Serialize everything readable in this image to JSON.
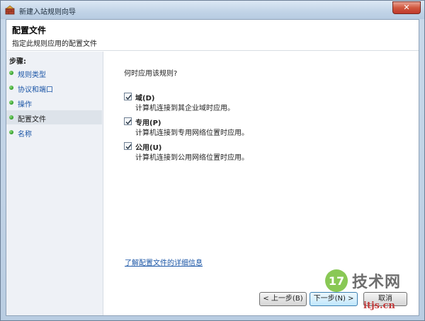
{
  "window": {
    "title": "新建入站规则向导",
    "close_glyph": "✕"
  },
  "header": {
    "title": "配置文件",
    "subtitle": "指定此规则应用的配置文件"
  },
  "sidebar": {
    "label": "步骤:",
    "items": [
      {
        "label": "规则类型",
        "current": false
      },
      {
        "label": "协议和端口",
        "current": false
      },
      {
        "label": "操作",
        "current": false
      },
      {
        "label": "配置文件",
        "current": true
      },
      {
        "label": "名称",
        "current": false
      }
    ]
  },
  "main": {
    "question": "何时应用该规则?",
    "options": [
      {
        "label": "域(D)",
        "description": "计算机连接到其企业域时应用。",
        "checked": true
      },
      {
        "label": "专用(P)",
        "description": "计算机连接到专用网络位置时应用。",
        "checked": true
      },
      {
        "label": "公用(U)",
        "description": "计算机连接到公用网络位置时应用。",
        "checked": true
      }
    ],
    "learn_more": "了解配置文件的详细信息"
  },
  "buttons": {
    "prev": "< 上一步(B)",
    "next": "下一步(N) >",
    "cancel": "取消"
  },
  "watermark": {
    "brand": "技术网",
    "url": "itjs.cn"
  },
  "colors": {
    "link": "#1a55a6",
    "step_dot": "#2f9a28",
    "titlebar": "#c3d5e8"
  }
}
